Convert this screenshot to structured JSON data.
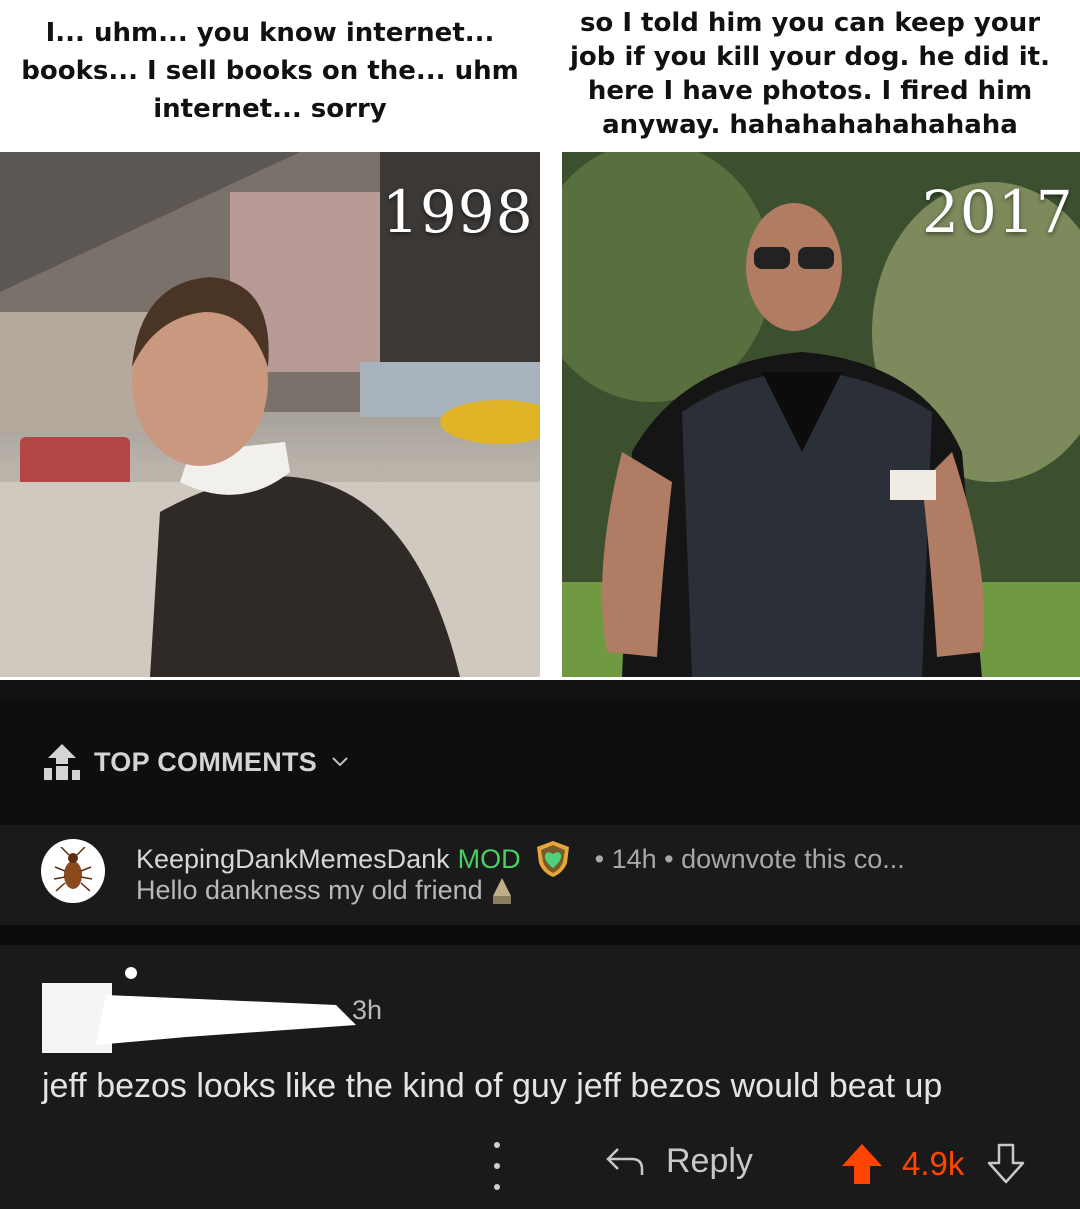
{
  "meme": {
    "caption_left": "I... uhm... you know internet... books... I sell books on the... uhm internet... sorry",
    "caption_right": "so I told him you can keep your job if you kill your dog. he did it. here I have photos. I fired him anyway. hahahahahahahaha",
    "year_left": "1998",
    "year_right": "2017"
  },
  "comments_header": {
    "sort_label": "TOP COMMENTS",
    "icon": "sort-top-icon"
  },
  "mod_comment": {
    "username": "KeepingDankMemesDank",
    "tag": "MOD",
    "meta": "• 14h • downvote this co...",
    "text": "Hello dankness my old friend",
    "avatar_icon": "cockroach-icon",
    "badge_icon": "shield-heart-icon"
  },
  "comment": {
    "time": "3h",
    "body": "jeff bezos looks like the kind of guy jeff bezos would beat up",
    "reply_label": "Reply",
    "score": "4.9k"
  },
  "colors": {
    "upvote": "#ff4500",
    "mod_green": "#46d160",
    "background": "#1a1a1b"
  }
}
